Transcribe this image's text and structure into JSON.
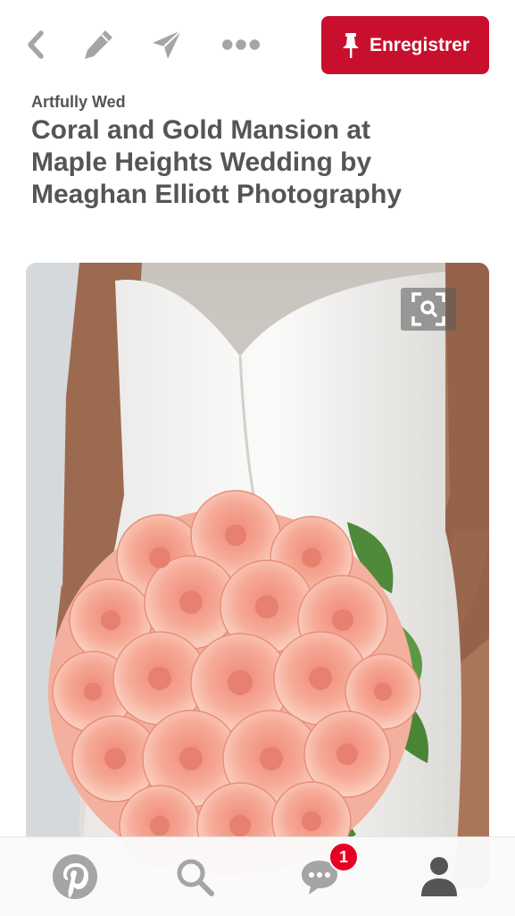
{
  "toolbar": {
    "back_icon": "chevron-left-icon",
    "edit_icon": "pencil-icon",
    "send_icon": "paper-plane-icon",
    "more_icon": "more-dots-icon",
    "save_label": "Enregistrer",
    "save_icon": "pushpin-icon"
  },
  "pin": {
    "source": "Artfully Wed",
    "title": "Coral and Gold Mansion at Maple Heights Wedding by Meaghan Elliott Photography",
    "image_icon": "visual-search-icon"
  },
  "tabbar": {
    "home_icon": "pinterest-logo-icon",
    "search_icon": "search-icon",
    "messages_icon": "chat-bubble-icon",
    "messages_badge": "1",
    "profile_icon": "person-icon"
  },
  "colors": {
    "brand": "#c8102e",
    "badge": "#e60023",
    "icon_gray": "#a5a5a5",
    "text": "#555555"
  }
}
